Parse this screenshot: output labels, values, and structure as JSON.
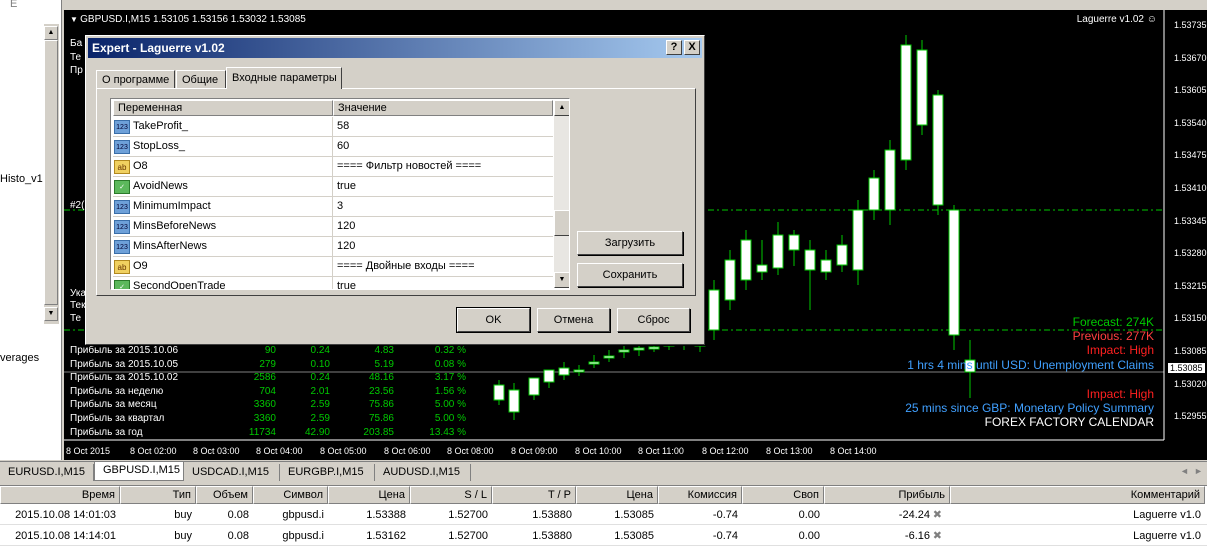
{
  "left_panel": {
    "lines": [
      "E",
      "Histo_v1",
      "verages"
    ]
  },
  "chart": {
    "title": "GBPUSD.I,M15  1.53105 1.53156 1.53032 1.53085",
    "indicator_label": "Laguerre v1.02",
    "y_labels": [
      "1.53735",
      "1.53670",
      "1.53605",
      "1.53540",
      "1.53475",
      "1.53410",
      "1.53345",
      "1.53280",
      "1.53215",
      "1.53150",
      "1.53085",
      "1.53020",
      "1.52955"
    ],
    "x_labels": [
      "8 Oct 2015",
      "8 Oct 02:00",
      "8 Oct 03:00",
      "8 Oct 04:00",
      "8 Oct 05:00",
      "8 Oct 06:00",
      "8 Oct 08:00",
      "8 Oct 09:00",
      "8 Oct 10:00",
      "8 Oct 11:00",
      "8 Oct 12:00",
      "8 Oct 13:00",
      "8 Oct 14:00"
    ],
    "current_price": "1.53085",
    "overlay_fragments": [
      "Ба",
      "Те",
      "Пр",
      "#2(",
      "Ука",
      "Тек",
      "Те"
    ],
    "news": {
      "forecast": "Forecast: 274K",
      "previous": "Previous: 277K",
      "impact1": "Impact: High",
      "event1": "1 hrs 4 mins until USD: Unemployment Claims",
      "impact2": "Impact: High",
      "event2": "25 mins since GBP: Monetary Policy Summary",
      "footer": "FOREX FACTORY CALENDAR"
    },
    "account_rows": [
      {
        "label": "Прибыль за 2015.10.06",
        "v1": "90",
        "v2": "0.24",
        "v3": "4.83",
        "v4": "0.32 %"
      },
      {
        "label": "Прибыль за 2015.10.05",
        "v1": "279",
        "v2": "0.10",
        "v3": "5.19",
        "v4": "0.08 %"
      },
      {
        "label": "Прибыль за 2015.10.02",
        "v1": "2586",
        "v2": "0.24",
        "v3": "48.16",
        "v4": "3.17 %"
      },
      {
        "label": "Прибыль за неделю",
        "v1": "704",
        "v2": "2.01",
        "v3": "23.56",
        "v4": "1.56 %"
      },
      {
        "label": "Прибыль за месяц",
        "v1": "3360",
        "v2": "2.59",
        "v3": "75.86",
        "v4": "5.00 %"
      },
      {
        "label": "Прибыль за квартал",
        "v1": "3360",
        "v2": "2.59",
        "v3": "75.86",
        "v4": "5.00 %"
      },
      {
        "label": "Прибыль за год",
        "v1": "11734",
        "v2": "42.90",
        "v3": "203.85",
        "v4": "13.43 %"
      }
    ]
  },
  "dialog": {
    "title": "Expert - Laguerre v1.02",
    "help_btn": "?",
    "close_btn": "X",
    "tabs": [
      "О программе",
      "Общие",
      "Входные параметры"
    ],
    "col_variable": "Переменная",
    "col_value": "Значение",
    "params": [
      {
        "icon": "number",
        "glyph": "123",
        "name": "TakeProfit_",
        "value": "58"
      },
      {
        "icon": "number",
        "glyph": "123",
        "name": "StopLoss_",
        "value": "60"
      },
      {
        "icon": "string",
        "glyph": "ab",
        "name": "O8",
        "value": "==== Фильтр новостей ===="
      },
      {
        "icon": "bool",
        "glyph": "✓",
        "name": "AvoidNews",
        "value": "true"
      },
      {
        "icon": "number",
        "glyph": "123",
        "name": "MinimumImpact",
        "value": "3"
      },
      {
        "icon": "number",
        "glyph": "123",
        "name": "MinsBeforeNews",
        "value": "120"
      },
      {
        "icon": "number",
        "glyph": "123",
        "name": "MinsAfterNews",
        "value": "120"
      },
      {
        "icon": "string",
        "glyph": "ab",
        "name": "O9",
        "value": "==== Двойные входы ===="
      },
      {
        "icon": "bool",
        "glyph": "✓",
        "name": "SecondOpenTrade",
        "value": "true"
      }
    ],
    "load_btn": "Загрузить",
    "save_btn": "Сохранить",
    "ok_btn": "OK",
    "cancel_btn": "Отмена",
    "reset_btn": "Сброс"
  },
  "chart_tabs": [
    "EURUSD.I,M15",
    "GBPUSD.I,M15",
    "USDCAD.I,M15",
    "EURGBP.I,M15",
    "AUDUSD.I,M15"
  ],
  "terminal": {
    "headers": [
      "Время",
      "Тип",
      "Объем",
      "Символ",
      "Цена",
      "S / L",
      "T / P",
      "Цена",
      "Комиссия",
      "Своп",
      "Прибыль",
      "Комментарий"
    ],
    "rows": [
      [
        "2015.10.08 14:01:03",
        "buy",
        "0.08",
        "gbpusd.i",
        "1.53388",
        "1.52700",
        "1.53880",
        "1.53085",
        "-0.74",
        "0.00",
        "-24.24",
        "Laguerre v1.0"
      ],
      [
        "2015.10.08 14:14:01",
        "buy",
        "0.08",
        "gbpusd.i",
        "1.53162",
        "1.52700",
        "1.53880",
        "1.53085",
        "-0.74",
        "0.00",
        "-6.16",
        "Laguerre v1.0"
      ]
    ]
  },
  "colors": {
    "bull": "#ffffff",
    "bear": "#000000",
    "wick": "#00c800",
    "grid_line": "#00c800",
    "forecast": "#00c800",
    "previous": "#ff4040",
    "impact": "#ff2020",
    "event": "#40a0ff",
    "title_bar": "#0a246a"
  }
}
